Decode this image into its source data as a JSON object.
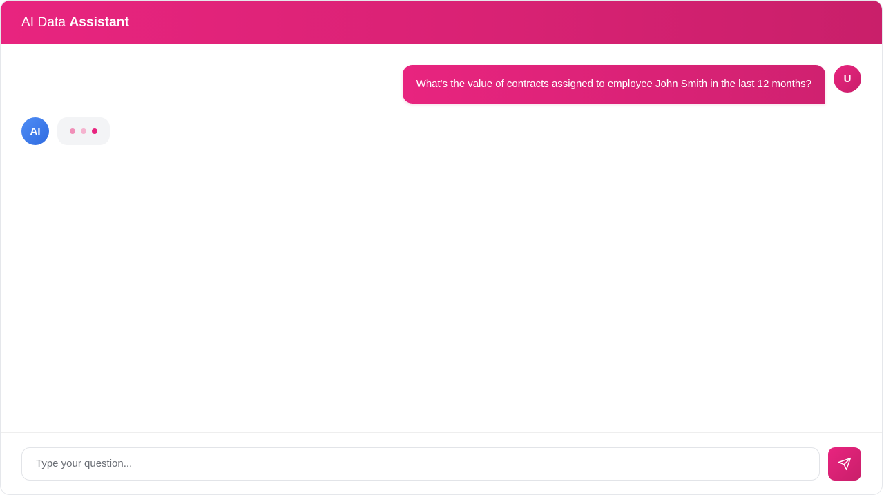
{
  "header": {
    "title_regular": "AI Data",
    "title_strong": "Assistant"
  },
  "messages": [
    {
      "role": "user",
      "avatar": "U",
      "text": "What's the value of contracts assigned to employee John Smith in the last 12 months?"
    },
    {
      "role": "ai",
      "avatar": "AI",
      "state": "typing"
    }
  ],
  "composer": {
    "placeholder": "Type your question...",
    "value": "",
    "send_icon": "send-icon"
  },
  "colors": {
    "brand": "#e8247f",
    "brand_dark": "#c91f6a",
    "ai_avatar": "#3b7ae8",
    "typing_bubble": "#f3f4f6"
  }
}
